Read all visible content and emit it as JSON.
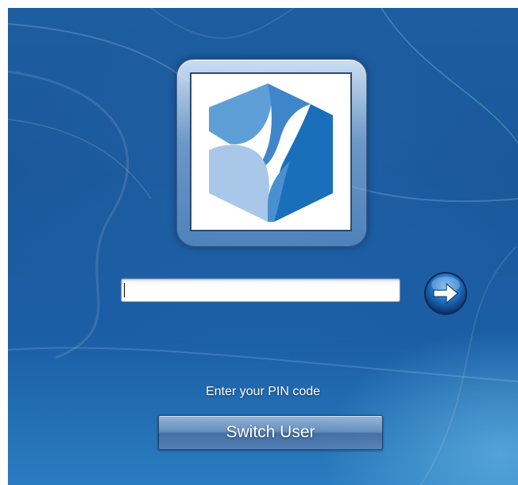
{
  "login": {
    "pin_value": "",
    "prompt": "Enter your PIN code",
    "switch_user_label": "Switch User"
  },
  "icons": {
    "user_tile": "cube-logo-icon",
    "submit": "arrow-right-icon"
  },
  "colors": {
    "background": "#1c5fa6",
    "logo_light": "#a8c8e8",
    "logo_mid": "#5a9bd5",
    "logo_dark": "#1a6fba"
  }
}
